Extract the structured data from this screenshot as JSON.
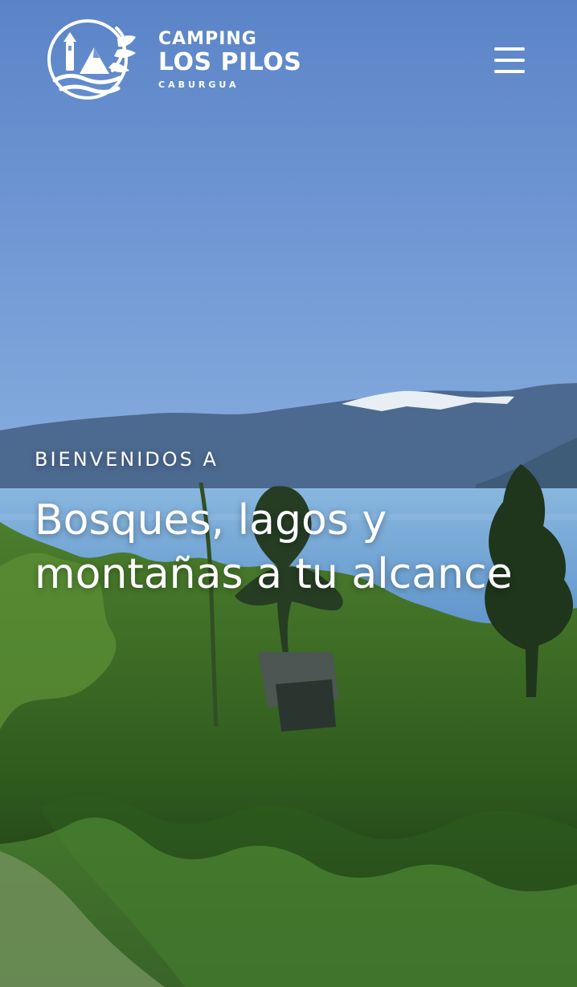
{
  "header": {
    "brand": {
      "line1": "CAMPING",
      "line2": "LOS PILOS",
      "line3": "CABURGUA"
    },
    "menu_icon": "hamburger-menu-icon"
  },
  "hero": {
    "eyebrow": "BIENVENIDOS A",
    "title_line1": "Bosques, lagos y",
    "title_line2": "montañas a tu alcance"
  },
  "colors": {
    "sky_top": "#5d86c9",
    "sky_bottom": "#8eb3e7",
    "mountain": "#4f6b91",
    "lake": "#6f9fd1",
    "forest_dark": "#1e3518",
    "forest_mid": "#3f6f24",
    "text": "#ffffff"
  }
}
